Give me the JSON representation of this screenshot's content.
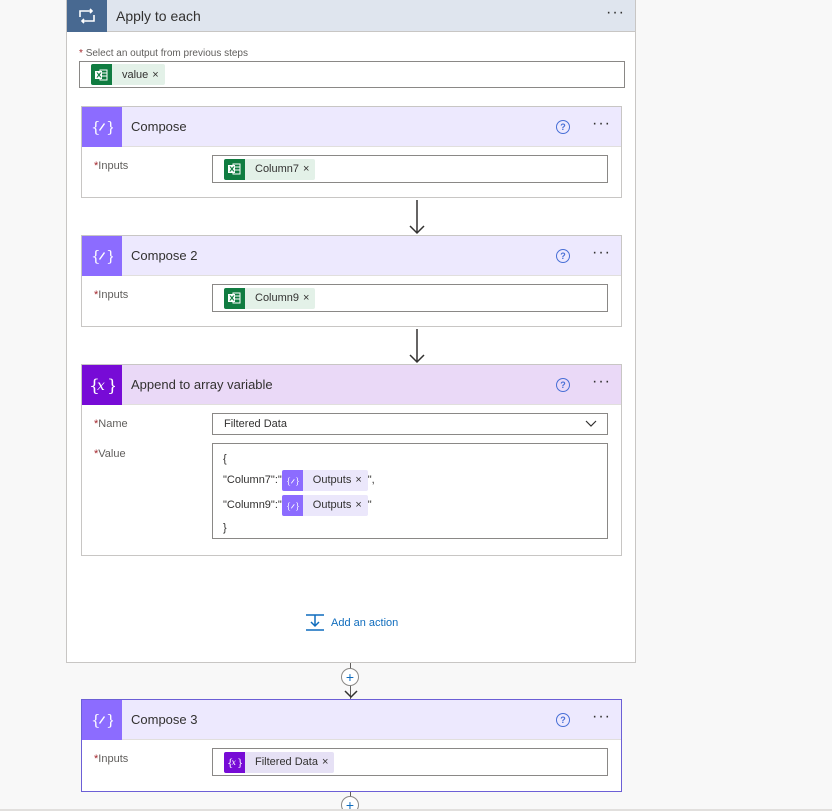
{
  "apply_each": {
    "title": "Apply to each",
    "select_label": "Select an output from previous steps",
    "token": "value"
  },
  "compose1": {
    "title": "Compose",
    "inputs_label": "Inputs",
    "token": "Column7"
  },
  "compose2": {
    "title": "Compose 2",
    "inputs_label": "Inputs",
    "token": "Column9"
  },
  "append": {
    "title": "Append to array variable",
    "name_label": "Name",
    "name_value": "Filtered Data",
    "value_label": "Value",
    "line1": "{",
    "line2_prefix": "\"Column7\":\"",
    "line2_token": "Outputs",
    "line2_suffix": "\",",
    "line3_prefix": "\"Column9\":\"",
    "line3_token": "Outputs",
    "line3_suffix": "\"",
    "line4": "}"
  },
  "add_action": "Add an action",
  "compose3": {
    "title": "Compose 3",
    "inputs_label": "Inputs",
    "token": "Filtered Data"
  },
  "required_mark": "*",
  "more_glyph": "···",
  "help_glyph": "?",
  "remove_glyph": "×",
  "plus_glyph": "+",
  "colors": {
    "apply_header": "#dfe5ee",
    "apply_icon": "#486991",
    "compose_accent": "#8c6cff",
    "variable_accent": "#770bd6",
    "excel_green": "#107c41",
    "link_blue": "#0f6cbd"
  }
}
